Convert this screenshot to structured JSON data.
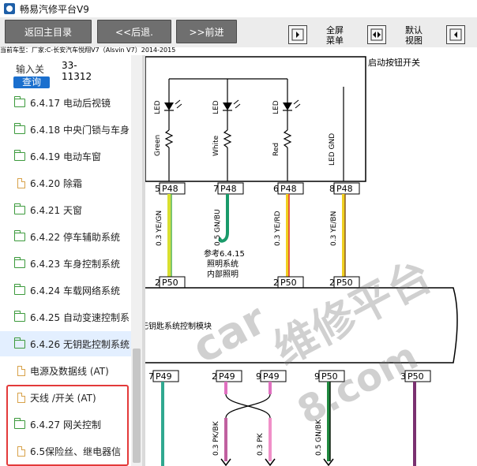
{
  "app": {
    "title": "畅易汽修平台V9"
  },
  "toolbar": {
    "home_label": "返回主目录",
    "back_label": "<<后退.",
    "forward_label": ">>前进",
    "fullscreen_label": [
      "全屏",
      "菜单"
    ],
    "default_view_label": [
      "默认",
      "视图"
    ]
  },
  "brand_line": "当前车型：厂家:C-长安汽车悦翔V7（Alsvin V7）2014-2015",
  "search": {
    "label": "输入关",
    "code": [
      "33-",
      "11312"
    ],
    "query_label": "查询"
  },
  "tree": [
    {
      "icon": "folder",
      "label": "6.4.17 电动后视镜"
    },
    {
      "icon": "folder",
      "label": "6.4.18 中央门锁与车身"
    },
    {
      "icon": "folder",
      "label": "6.4.19 电动车窗"
    },
    {
      "icon": "doc",
      "label": "6.4.20 除霜"
    },
    {
      "icon": "folder",
      "label": "6.4.21 天窗"
    },
    {
      "icon": "folder",
      "label": "6.4.22 停车辅助系统"
    },
    {
      "icon": "folder",
      "label": "6.4.23 车身控制系统"
    },
    {
      "icon": "folder",
      "label": "6.4.24 车载网络系统"
    },
    {
      "icon": "folder",
      "label": "6.4.25 自动变速控制系"
    },
    {
      "icon": "folder",
      "label": "6.4.26 无钥匙控制系统",
      "selected": true
    },
    {
      "icon": "doc",
      "label": "电源及数据线 (AT)",
      "indent": true
    },
    {
      "icon": "doc",
      "label": "天线 /开关 (AT)",
      "indent": true
    },
    {
      "icon": "folder",
      "label": "6.4.27 网关控制"
    },
    {
      "icon": "doc",
      "label": "6.5保险丝、继电器信"
    }
  ],
  "diagram": {
    "top_label": "启动按钮开关",
    "led_labels": [
      "LED",
      "LED",
      "LED"
    ],
    "wire_labels": [
      "Green",
      "White",
      "Red",
      "LED GND"
    ],
    "top_pins": [
      {
        "pin": "5",
        "conn": "P48"
      },
      {
        "pin": "7",
        "conn": "P48"
      },
      {
        "pin": "6",
        "conn": "P48"
      },
      {
        "pin": "8",
        "conn": "P48"
      }
    ],
    "top_wires": [
      "0.3 YE/GN",
      "0.5 GN/BU",
      "0.3 YE/RD",
      "0.3 YE/BN"
    ],
    "ref_note": [
      "参考6.4.15",
      "照明系统",
      "内部照明"
    ],
    "mid_pins": [
      {
        "pin": "24",
        "conn": "P50"
      },
      {
        "pin": "25",
        "conn": "P50"
      },
      {
        "pin": "27",
        "conn": "P50"
      }
    ],
    "module_label": "无钥匙系统控制模块",
    "bottom_pins": [
      {
        "pin": "7",
        "conn": "P49"
      },
      {
        "pin": "20",
        "conn": "P49"
      },
      {
        "pin": "9",
        "conn": "P49"
      },
      {
        "pin": "9",
        "conn": "P50"
      },
      {
        "pin": "30",
        "conn": "P50"
      }
    ],
    "bottom_wires": [
      "0.3 PK/BK",
      "0.3 PK",
      "0.5 GN/BK"
    ],
    "watermark": [
      "car",
      "维修平台",
      "8.com"
    ]
  }
}
